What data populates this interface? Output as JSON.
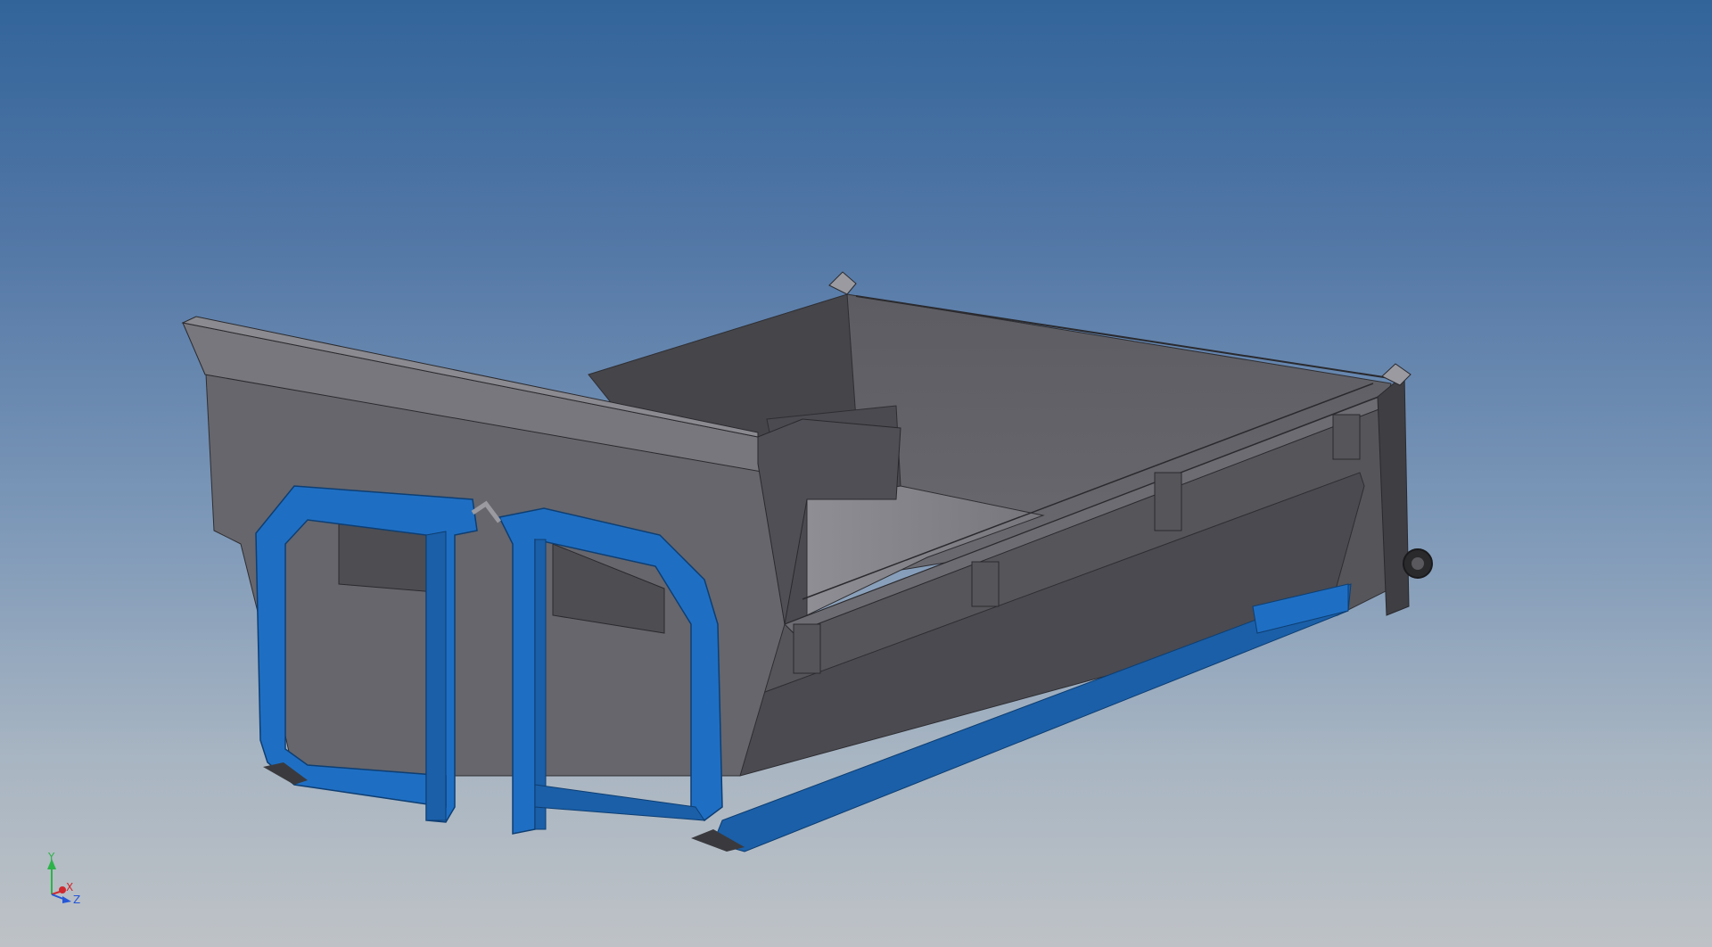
{
  "viewport": {
    "background_top": "#32649a",
    "background_bottom": "#bec2c6"
  },
  "model": {
    "body_color": "#5f5f64",
    "frame_color": "#1e6fc4"
  },
  "triad": {
    "y_label": "Y",
    "x_label": "X",
    "z_label": "Z",
    "y_color": "#2db34a",
    "x_color": "#d0282f",
    "z_color": "#2456d8"
  }
}
